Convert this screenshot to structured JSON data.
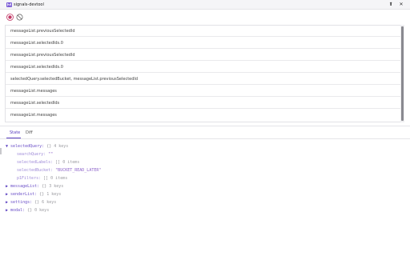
{
  "window": {
    "title": "signals-devtool",
    "pin_glyph": "⬆",
    "close_glyph": "✕"
  },
  "colors": {
    "accent": "#5a3fc0",
    "record": "#c23a67"
  },
  "messages": [
    "messageList.previousSelectedId",
    "messageList.selectedIds.0",
    "messageList.previousSelectedId",
    "messageList.selectedIds.0",
    "selectedQuery.selectedBucket, messageList.previousSelectedId",
    "messageList.messages",
    "messageList.selectedIds",
    "messageList.messages"
  ],
  "tabs": {
    "state": "State",
    "diff": "Diff"
  },
  "tree": {
    "selectedQuery": {
      "arrow": "▼",
      "key": "selectedQuery:",
      "meta": "{} 4 keys"
    },
    "searchQuery": {
      "key": "searchQuery:",
      "value": "\"\""
    },
    "selectedLabels": {
      "key": "selectedLabels:",
      "meta": "[] 0 items"
    },
    "selectedBucket": {
      "key": "selectedBucket:",
      "value": "\"BUCKET_READ_LATER\""
    },
    "p1Filters": {
      "key": "p1Filters:",
      "meta": "[] 0 items"
    },
    "messageList": {
      "arrow": "▶",
      "key": "messageList:",
      "meta": "{} 3 keys"
    },
    "senderList": {
      "arrow": "▶",
      "key": "senderList:",
      "meta": "{} 1 keys"
    },
    "settings": {
      "arrow": "▶",
      "key": "settings:",
      "meta": "{} 6 keys"
    },
    "modal": {
      "arrow": "▶",
      "key": "modal:",
      "meta": "{} 0 keys"
    }
  }
}
